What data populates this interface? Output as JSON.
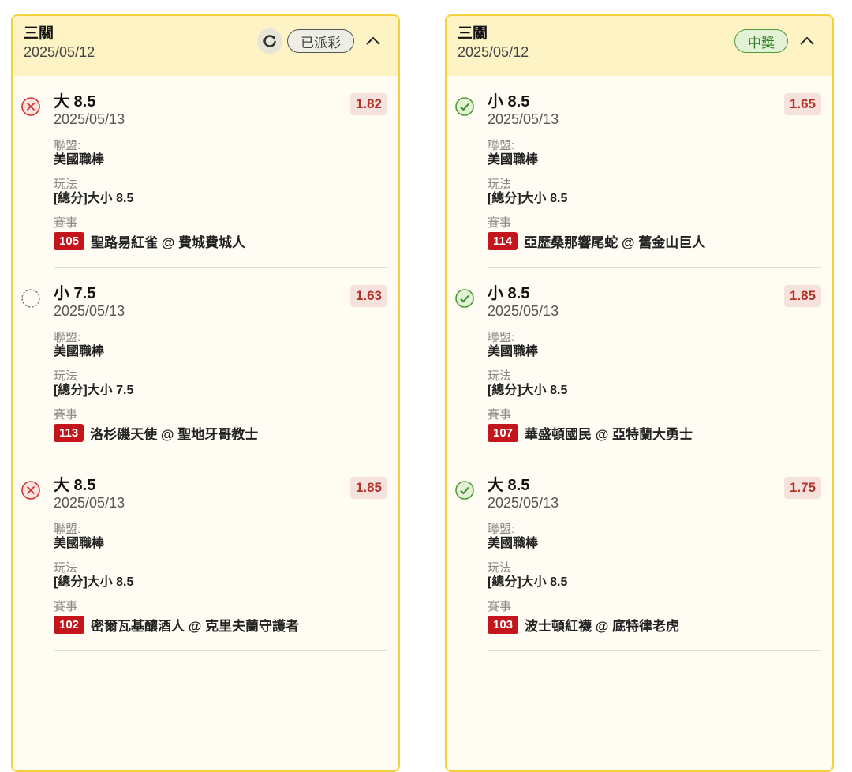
{
  "cards": [
    {
      "title": "三關",
      "date": "2025/05/12",
      "status": "已派彩",
      "bets": [
        {
          "selection": "大 8.5",
          "date": "2025/05/13",
          "odds": "1.82",
          "result": "lost",
          "league_label": "聯盟:",
          "league": "美國職棒",
          "type_label": "玩法",
          "type": "[總分]大小 8.5",
          "match_label": "賽事",
          "match_no": "105",
          "match": "聖路易紅雀 @ 費城費城人"
        },
        {
          "selection": "小 7.5",
          "date": "2025/05/13",
          "odds": "1.63",
          "result": "pending",
          "league_label": "聯盟:",
          "league": "美國職棒",
          "type_label": "玩法",
          "type": "[總分]大小 7.5",
          "match_label": "賽事",
          "match_no": "113",
          "match": "洛杉磯天使 @ 聖地牙哥教士"
        },
        {
          "selection": "大 8.5",
          "date": "2025/05/13",
          "odds": "1.85",
          "result": "lost",
          "league_label": "聯盟:",
          "league": "美國職棒",
          "type_label": "玩法",
          "type": "[總分]大小 8.5",
          "match_label": "賽事",
          "match_no": "102",
          "match": "密爾瓦基釀酒人 @ 克里夫蘭守護者"
        }
      ]
    },
    {
      "title": "三關",
      "date": "2025/05/12",
      "status": "中獎",
      "bets": [
        {
          "selection": "小 8.5",
          "date": "2025/05/13",
          "odds": "1.65",
          "result": "won",
          "league_label": "聯盟:",
          "league": "美國職棒",
          "type_label": "玩法",
          "type": "[總分]大小 8.5",
          "match_label": "賽事",
          "match_no": "114",
          "match": "亞歷桑那響尾蛇 @ 舊金山巨人"
        },
        {
          "selection": "小 8.5",
          "date": "2025/05/13",
          "odds": "1.85",
          "result": "won",
          "league_label": "聯盟:",
          "league": "美國職棒",
          "type_label": "玩法",
          "type": "[總分]大小 8.5",
          "match_label": "賽事",
          "match_no": "107",
          "match": "華盛頓國民 @ 亞特蘭大勇士"
        },
        {
          "selection": "大 8.5",
          "date": "2025/05/13",
          "odds": "1.75",
          "result": "won",
          "league_label": "聯盟:",
          "league": "美國職棒",
          "type_label": "玩法",
          "type": "[總分]大小 8.5",
          "match_label": "賽事",
          "match_no": "103",
          "match": "波士頓紅襪 @ 底特律老虎"
        }
      ]
    }
  ],
  "icons": {
    "refresh": "refresh-icon",
    "collapse": "chevron-up-icon",
    "lost": "x-circle-icon",
    "won": "check-circle-icon",
    "pending": "dashed-circle-icon"
  },
  "colors": {
    "card_border": "#f2d23c",
    "header_bg": "#fdf3c4",
    "odds_text": "#b3322a",
    "match_badge": "#c3161c",
    "won": "#4e9a3a",
    "lost": "#d2342c"
  }
}
